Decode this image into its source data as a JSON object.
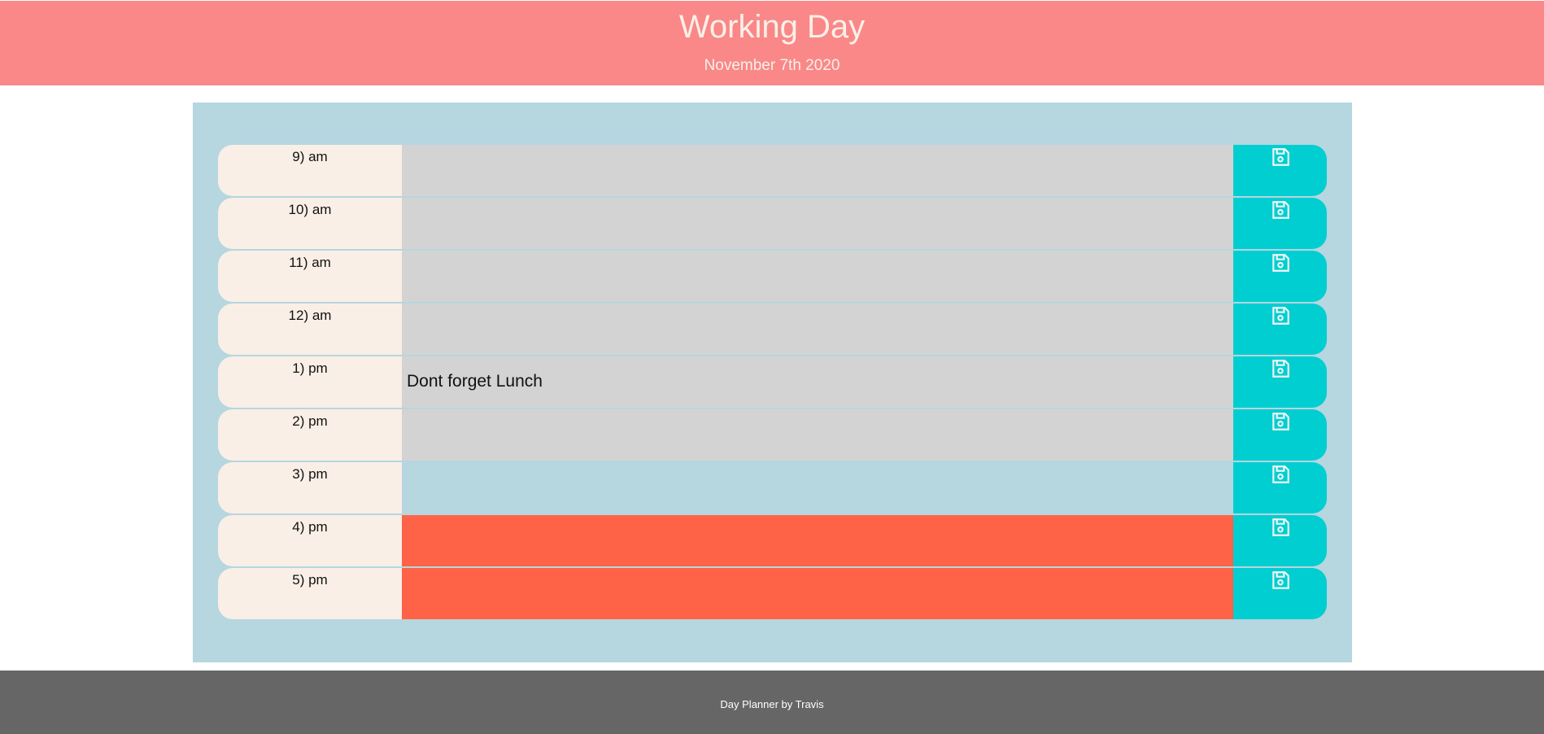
{
  "header": {
    "title": "Working Day",
    "date": "November 7th 2020"
  },
  "rows": [
    {
      "hour": "9) am",
      "description": "",
      "status": "past"
    },
    {
      "hour": "10) am",
      "description": "",
      "status": "past"
    },
    {
      "hour": "11) am",
      "description": "",
      "status": "past"
    },
    {
      "hour": "12) am",
      "description": "",
      "status": "past"
    },
    {
      "hour": "1) pm",
      "description": "Dont forget Lunch",
      "status": "past"
    },
    {
      "hour": "2) pm",
      "description": "",
      "status": "past"
    },
    {
      "hour": "3) pm",
      "description": "",
      "status": "present"
    },
    {
      "hour": "4) pm",
      "description": "",
      "status": "future"
    },
    {
      "hour": "5) pm",
      "description": "",
      "status": "future"
    }
  ],
  "save_icon": "floppy-disk-icon",
  "footer": {
    "text": "Day Planner by Travis"
  },
  "colors": {
    "header_bg": "#fa8888",
    "past": "#d3d3d3",
    "present": "#b6d6e0",
    "future": "#ff6347",
    "save_bg": "#00ced1",
    "footer_bg": "#666666"
  }
}
